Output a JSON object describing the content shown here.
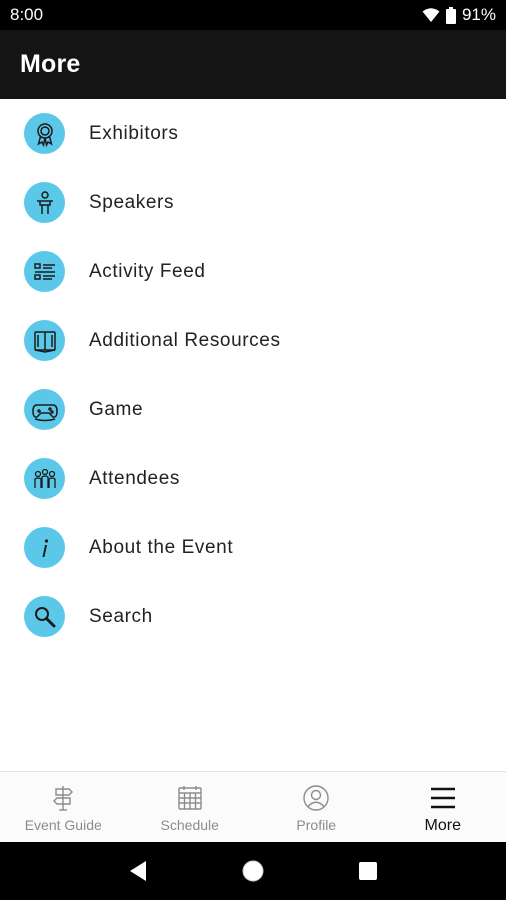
{
  "status_bar": {
    "time": "8:00",
    "battery": "91%"
  },
  "header": {
    "title": "More"
  },
  "menu": {
    "items": [
      {
        "label": "Exhibitors",
        "icon": "ribbon-icon"
      },
      {
        "label": "Speakers",
        "icon": "podium-speaker-icon"
      },
      {
        "label": "Activity Feed",
        "icon": "list-feed-icon"
      },
      {
        "label": "Additional Resources",
        "icon": "book-icon"
      },
      {
        "label": "Game",
        "icon": "gamepad-icon"
      },
      {
        "label": "Attendees",
        "icon": "group-icon"
      },
      {
        "label": "About the Event",
        "icon": "info-icon"
      },
      {
        "label": "Search",
        "icon": "search-icon"
      }
    ]
  },
  "bottom_nav": {
    "tabs": [
      {
        "label": "Event Guide",
        "icon": "signpost-icon",
        "active": false
      },
      {
        "label": "Schedule",
        "icon": "calendar-icon",
        "active": false
      },
      {
        "label": "Profile",
        "icon": "profile-icon",
        "active": false
      },
      {
        "label": "More",
        "icon": "hamburger-menu-icon",
        "active": true
      }
    ]
  },
  "colors": {
    "icon_background": "#5bc8ea",
    "app_bar": "#141414",
    "status_bar": "#000000"
  }
}
